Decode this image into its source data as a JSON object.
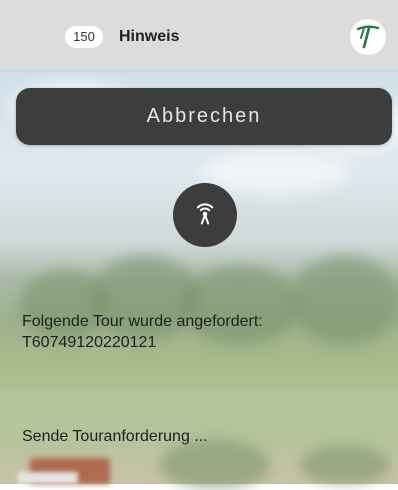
{
  "header": {
    "badge": "150",
    "title": "Hinweis",
    "logo_letter": "T",
    "logo_color": "#1d7b45"
  },
  "actions": {
    "cancel_label": "Abbrechen"
  },
  "content": {
    "tour_label": "Folgende Tour wurde angefordert:",
    "tour_id": "T60749120220121",
    "status": "Sende Touranforderung ..."
  },
  "icons": {
    "logo": "app-logo-icon",
    "signal": "signal-antenna-icon"
  }
}
